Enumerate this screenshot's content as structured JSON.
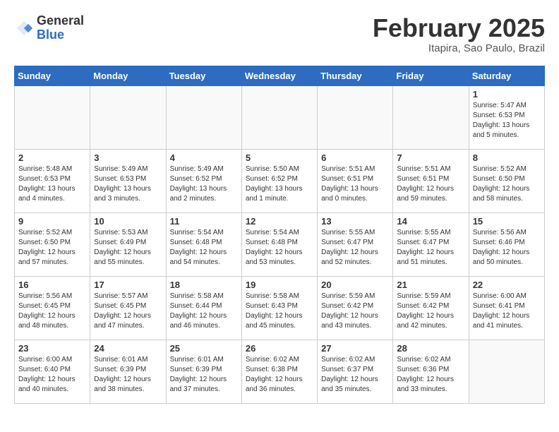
{
  "logo": {
    "general": "General",
    "blue": "Blue"
  },
  "title": "February 2025",
  "location": "Itapira, Sao Paulo, Brazil",
  "days_header": [
    "Sunday",
    "Monday",
    "Tuesday",
    "Wednesday",
    "Thursday",
    "Friday",
    "Saturday"
  ],
  "weeks": [
    [
      {
        "day": "",
        "info": ""
      },
      {
        "day": "",
        "info": ""
      },
      {
        "day": "",
        "info": ""
      },
      {
        "day": "",
        "info": ""
      },
      {
        "day": "",
        "info": ""
      },
      {
        "day": "",
        "info": ""
      },
      {
        "day": "1",
        "info": "Sunrise: 5:47 AM\nSunset: 6:53 PM\nDaylight: 13 hours\nand 5 minutes."
      }
    ],
    [
      {
        "day": "2",
        "info": "Sunrise: 5:48 AM\nSunset: 6:53 PM\nDaylight: 13 hours\nand 4 minutes."
      },
      {
        "day": "3",
        "info": "Sunrise: 5:49 AM\nSunset: 6:53 PM\nDaylight: 13 hours\nand 3 minutes."
      },
      {
        "day": "4",
        "info": "Sunrise: 5:49 AM\nSunset: 6:52 PM\nDaylight: 13 hours\nand 2 minutes."
      },
      {
        "day": "5",
        "info": "Sunrise: 5:50 AM\nSunset: 6:52 PM\nDaylight: 13 hours\nand 1 minute."
      },
      {
        "day": "6",
        "info": "Sunrise: 5:51 AM\nSunset: 6:51 PM\nDaylight: 13 hours\nand 0 minutes."
      },
      {
        "day": "7",
        "info": "Sunrise: 5:51 AM\nSunset: 6:51 PM\nDaylight: 12 hours\nand 59 minutes."
      },
      {
        "day": "8",
        "info": "Sunrise: 5:52 AM\nSunset: 6:50 PM\nDaylight: 12 hours\nand 58 minutes."
      }
    ],
    [
      {
        "day": "9",
        "info": "Sunrise: 5:52 AM\nSunset: 6:50 PM\nDaylight: 12 hours\nand 57 minutes."
      },
      {
        "day": "10",
        "info": "Sunrise: 5:53 AM\nSunset: 6:49 PM\nDaylight: 12 hours\nand 55 minutes."
      },
      {
        "day": "11",
        "info": "Sunrise: 5:54 AM\nSunset: 6:48 PM\nDaylight: 12 hours\nand 54 minutes."
      },
      {
        "day": "12",
        "info": "Sunrise: 5:54 AM\nSunset: 6:48 PM\nDaylight: 12 hours\nand 53 minutes."
      },
      {
        "day": "13",
        "info": "Sunrise: 5:55 AM\nSunset: 6:47 PM\nDaylight: 12 hours\nand 52 minutes."
      },
      {
        "day": "14",
        "info": "Sunrise: 5:55 AM\nSunset: 6:47 PM\nDaylight: 12 hours\nand 51 minutes."
      },
      {
        "day": "15",
        "info": "Sunrise: 5:56 AM\nSunset: 6:46 PM\nDaylight: 12 hours\nand 50 minutes."
      }
    ],
    [
      {
        "day": "16",
        "info": "Sunrise: 5:56 AM\nSunset: 6:45 PM\nDaylight: 12 hours\nand 48 minutes."
      },
      {
        "day": "17",
        "info": "Sunrise: 5:57 AM\nSunset: 6:45 PM\nDaylight: 12 hours\nand 47 minutes."
      },
      {
        "day": "18",
        "info": "Sunrise: 5:58 AM\nSunset: 6:44 PM\nDaylight: 12 hours\nand 46 minutes."
      },
      {
        "day": "19",
        "info": "Sunrise: 5:58 AM\nSunset: 6:43 PM\nDaylight: 12 hours\nand 45 minutes."
      },
      {
        "day": "20",
        "info": "Sunrise: 5:59 AM\nSunset: 6:42 PM\nDaylight: 12 hours\nand 43 minutes."
      },
      {
        "day": "21",
        "info": "Sunrise: 5:59 AM\nSunset: 6:42 PM\nDaylight: 12 hours\nand 42 minutes."
      },
      {
        "day": "22",
        "info": "Sunrise: 6:00 AM\nSunset: 6:41 PM\nDaylight: 12 hours\nand 41 minutes."
      }
    ],
    [
      {
        "day": "23",
        "info": "Sunrise: 6:00 AM\nSunset: 6:40 PM\nDaylight: 12 hours\nand 40 minutes."
      },
      {
        "day": "24",
        "info": "Sunrise: 6:01 AM\nSunset: 6:39 PM\nDaylight: 12 hours\nand 38 minutes."
      },
      {
        "day": "25",
        "info": "Sunrise: 6:01 AM\nSunset: 6:39 PM\nDaylight: 12 hours\nand 37 minutes."
      },
      {
        "day": "26",
        "info": "Sunrise: 6:02 AM\nSunset: 6:38 PM\nDaylight: 12 hours\nand 36 minutes."
      },
      {
        "day": "27",
        "info": "Sunrise: 6:02 AM\nSunset: 6:37 PM\nDaylight: 12 hours\nand 35 minutes."
      },
      {
        "day": "28",
        "info": "Sunrise: 6:02 AM\nSunset: 6:36 PM\nDaylight: 12 hours\nand 33 minutes."
      },
      {
        "day": "",
        "info": ""
      }
    ]
  ]
}
